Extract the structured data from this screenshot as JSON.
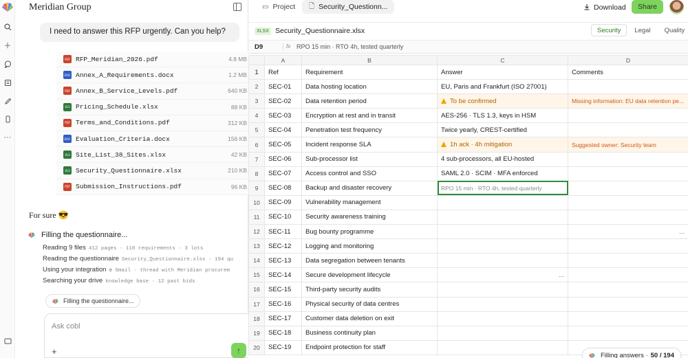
{
  "rail": {
    "icons": [
      "search-icon",
      "plus-icon",
      "chat-icon",
      "document-icon",
      "pen-icon",
      "phone-icon",
      "more-icon",
      "panel-icon"
    ]
  },
  "chat": {
    "title": "Meridian Group",
    "user_message": "I need to answer this RFP urgently. Can you help?",
    "files": [
      {
        "type": "PDF",
        "name": "RFP_Meridian_2026.pdf",
        "size": "4.8 MB",
        "color": "#c9452e"
      },
      {
        "type": "DOC",
        "name": "Annex_A_Requirements.docx",
        "size": "1.2 MB",
        "color": "#2f5ec4"
      },
      {
        "type": "PDF",
        "name": "Annex_B_Service_Levels.pdf",
        "size": "640 KB",
        "color": "#c9452e"
      },
      {
        "type": "XLS",
        "name": "Pricing_Schedule.xlsx",
        "size": "88 KB",
        "color": "#2e7a3a"
      },
      {
        "type": "PDF",
        "name": "Terms_and_Conditions.pdf",
        "size": "312 KB",
        "color": "#c9452e"
      },
      {
        "type": "DOC",
        "name": "Evaluation_Criteria.docx",
        "size": "156 KB",
        "color": "#2f5ec4"
      },
      {
        "type": "XLS",
        "name": "Site_List_38_Sites.xlsx",
        "size": "42 KB",
        "color": "#2e7a3a"
      },
      {
        "type": "XLS",
        "name": "Security_Questionnaire.xlsx",
        "size": "210 KB",
        "color": "#2e7a3a"
      },
      {
        "type": "PDF",
        "name": "Submission_Instructions.pdf",
        "size": "96 KB",
        "color": "#c9452e"
      }
    ],
    "reply": "For sure 😎",
    "status_heading": "Filling the questionnaire...",
    "steps": [
      {
        "text": "Reading 9 files",
        "meta": "412 pages · 118 requirements · 3 lots"
      },
      {
        "text": "Reading the questionnaire",
        "meta": "Security_Questionnaire.xlsx · 194 qu"
      },
      {
        "text": "Using your integration",
        "meta": "⚙ Gmail · thread with Meridian procurem"
      },
      {
        "text": "Searching your drive",
        "meta": "knowledge base · 12 past bids"
      }
    ],
    "pill_label": "Filling the questionnaire...",
    "ask_placeholder": "Ask cobl",
    "plus_label": "+",
    "send_glyph": "↑"
  },
  "topbar": {
    "tabs": [
      {
        "icon": "monitor-icon",
        "glyph": "▭",
        "label": "Project"
      },
      {
        "icon": "file-icon",
        "glyph": "🗋",
        "label": "Security_Questionn..."
      }
    ],
    "download_label": "Download",
    "share_label": "Share"
  },
  "sheet": {
    "badge": "XLSX",
    "file_title": "Security_Questionnaire.xlsx",
    "sheet_tabs": [
      "Security",
      "Legal",
      "Quality"
    ],
    "active_sheet": "Security",
    "selected_cell": "D9",
    "fx_label": "fx",
    "formula_value": "RPO 15 min · RTO 4h, tested quarterly",
    "columns": [
      "A",
      "B",
      "C",
      "D"
    ],
    "headers": [
      "Ref",
      "Requirement",
      "Answer",
      "Comments"
    ],
    "header_row": "1",
    "rows": [
      {
        "n": "2",
        "ref": "SEC-01",
        "req": "Data hosting location",
        "ans": "EU, Paris and Frankfurt (ISO 27001)",
        "com": "",
        "state": ""
      },
      {
        "n": "3",
        "ref": "SEC-02",
        "req": "Data retention period",
        "ans": "To be confirmed",
        "com": "Missing information: EU data retention pe...",
        "state": "warn"
      },
      {
        "n": "4",
        "ref": "SEC-03",
        "req": "Encryption at rest and in transit",
        "ans": "AES-256 · TLS 1.3, keys in HSM",
        "com": "",
        "state": ""
      },
      {
        "n": "5",
        "ref": "SEC-04",
        "req": "Penetration test frequency",
        "ans": "Twice yearly, CREST-certified",
        "com": "",
        "state": ""
      },
      {
        "n": "6",
        "ref": "SEC-05",
        "req": "Incident response SLA",
        "ans": "1h ack · 4h mitigation",
        "com": "Suggested owner: Security team",
        "state": "warn"
      },
      {
        "n": "7",
        "ref": "SEC-06",
        "req": "Sub-processor list",
        "ans": "4 sub-processors, all EU-hosted",
        "com": "",
        "state": ""
      },
      {
        "n": "8",
        "ref": "SEC-07",
        "req": "Access control and SSO",
        "ans": "SAML 2.0 · SCIM · MFA enforced",
        "com": "",
        "state": ""
      },
      {
        "n": "9",
        "ref": "SEC-08",
        "req": "Backup and disaster recovery",
        "ans": "RPO 15 min · RTO 4h, tested quarterly",
        "com": "",
        "state": "sel"
      },
      {
        "n": "10",
        "ref": "SEC-09",
        "req": "Vulnerability management",
        "ans": "",
        "com": "",
        "state": ""
      },
      {
        "n": "11",
        "ref": "SEC-10",
        "req": "Security awareness training",
        "ans": "",
        "com": "",
        "state": ""
      },
      {
        "n": "12",
        "ref": "SEC-11",
        "req": "Bug bounty programme",
        "ans": "",
        "com": "...",
        "state": ""
      },
      {
        "n": "13",
        "ref": "SEC-12",
        "req": "Logging and monitoring",
        "ans": "",
        "com": "",
        "state": ""
      },
      {
        "n": "14",
        "ref": "SEC-13",
        "req": "Data segregation between tenants",
        "ans": "",
        "com": "",
        "state": ""
      },
      {
        "n": "15",
        "ref": "SEC-14",
        "req": "Secure development lifecycle",
        "ans": "...",
        "com": "",
        "state": ""
      },
      {
        "n": "16",
        "ref": "SEC-15",
        "req": "Third-party security audits",
        "ans": "",
        "com": "",
        "state": ""
      },
      {
        "n": "17",
        "ref": "SEC-16",
        "req": "Physical security of data centres",
        "ans": "",
        "com": "",
        "state": ""
      },
      {
        "n": "18",
        "ref": "SEC-17",
        "req": "Customer data deletion on exit",
        "ans": "",
        "com": "",
        "state": ""
      },
      {
        "n": "19",
        "ref": "SEC-18",
        "req": "Business continuity plan",
        "ans": "",
        "com": "",
        "state": ""
      },
      {
        "n": "20",
        "ref": "SEC-19",
        "req": "Endpoint protection for staff",
        "ans": "",
        "com": "",
        "state": ""
      }
    ]
  },
  "progress": {
    "label": "Filling answers ·",
    "count": "50 / 194",
    "fraction": 0.258
  },
  "colors": {
    "accent_green": "#7ed35f",
    "warning_bg": "#fff5e8",
    "warning_text": "#b36200",
    "selection": "#2e8b3a"
  }
}
